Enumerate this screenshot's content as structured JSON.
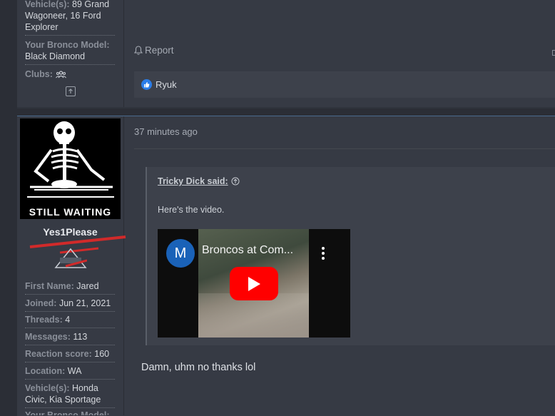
{
  "previous_post": {
    "sidebar": {
      "vehicles_value": "89 Grand Wagoneer, 16 Ford Explorer",
      "vehicles_key": "Vehicle(s):",
      "bronco_model_key": "Your Bronco Model:",
      "bronco_model_value": "Black Diamond",
      "clubs_key": "Clubs:"
    },
    "report_label": "Report",
    "reactions": {
      "names": "Ryuk"
    }
  },
  "post": {
    "avatar_caption": "STILL WAITING",
    "username": "Yes1Please",
    "stats": [
      {
        "key": "First Name:",
        "value": "Jared"
      },
      {
        "key": "Joined:",
        "value": "Jun 21, 2021"
      },
      {
        "key": "Threads:",
        "value": "4"
      },
      {
        "key": "Messages:",
        "value": "113"
      },
      {
        "key": "Reaction score:",
        "value": "160"
      },
      {
        "key": "Location:",
        "value": "WA"
      },
      {
        "key": "Vehicle(s):",
        "value": "Honda Civic, Kia Sportage"
      },
      {
        "key": "Your Bronco Model:",
        "value": ""
      }
    ],
    "timestamp": "37 minutes ago",
    "quote": {
      "author": "Tricky Dick said:",
      "text": "Here's the video."
    },
    "video": {
      "channel_initial": "M",
      "title": "Broncos at Com..."
    },
    "reply_text": "Damn, uhm no thanks lol"
  },
  "colors": {
    "accent_blue": "#2b7de9",
    "youtube_red": "#ff0000",
    "panel": "#363a44"
  }
}
